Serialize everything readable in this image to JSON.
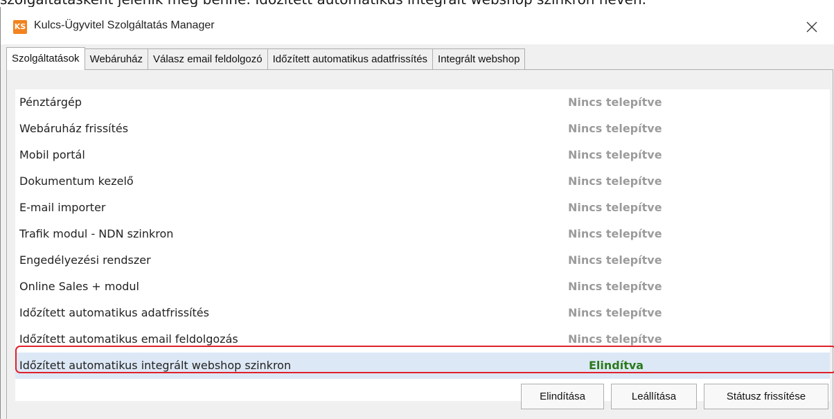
{
  "caption": "szolgáltatásként jelenik meg benne: Időzített automatikus integrált webshop szinkron néven.",
  "window": {
    "icon_text": "KS",
    "title": "Kulcs-Ügyvitel Szolgáltatás Manager",
    "close_glyph": "✕"
  },
  "tabs": [
    {
      "label": "Szolgáltatások",
      "active": true
    },
    {
      "label": "Webáruház",
      "active": false
    },
    {
      "label": "Válasz email feldolgozó",
      "active": false
    },
    {
      "label": "Időzített automatikus adatfrissítés",
      "active": false
    },
    {
      "label": "Integrált webshop",
      "active": false
    }
  ],
  "services": [
    {
      "name": "Pénztárgép",
      "status": "Nincs telepítve"
    },
    {
      "name": "Webáruház frissítés",
      "status": "Nincs telepítve"
    },
    {
      "name": "Mobil portál",
      "status": "Nincs telepítve"
    },
    {
      "name": "Dokumentum kezelő",
      "status": "Nincs telepítve"
    },
    {
      "name": "E-mail importer",
      "status": "Nincs telepítve"
    },
    {
      "name": "Trafik modul - NDN szinkron",
      "status": "Nincs telepítve"
    },
    {
      "name": "Engedélyezési rendszer",
      "status": "Nincs telepítve"
    },
    {
      "name": "Online Sales + modul",
      "status": "Nincs telepítve"
    },
    {
      "name": "Időzített automatikus adatfrissítés",
      "status": "Nincs telepítve"
    },
    {
      "name": "Időzített automatikus email feldolgozás",
      "status": "Nincs telepítve"
    },
    {
      "name": "Időzített automatikus integrált webshop szinkron",
      "status": "Elindítva",
      "selected": true
    }
  ],
  "buttons": {
    "start": "Elindítása",
    "stop": "Leállítása",
    "refresh": "Státusz frissítése"
  },
  "colors": {
    "status_not_installed": "#9b9b9b",
    "status_started": "#2a7a1a",
    "highlight": "#e0202a",
    "app_icon": "#f2831f"
  },
  "icons": {
    "app": "ks-app-icon",
    "close": "close-icon"
  }
}
